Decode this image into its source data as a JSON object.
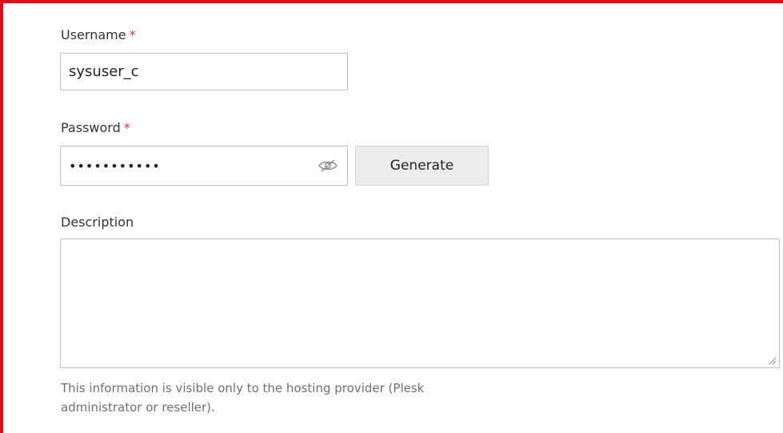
{
  "form": {
    "username": {
      "label": "Username",
      "required_mark": "*",
      "value": "sysuser_c"
    },
    "password": {
      "label": "Password",
      "required_mark": "*",
      "value": "•••••••••••",
      "toggle_icon": "eye-slash-icon",
      "generate_label": "Generate"
    },
    "description": {
      "label": "Description",
      "value": "",
      "help_line1": "This information is visible only to the hosting provider (Plesk",
      "help_line2": "administrator or reseller)."
    }
  },
  "colors": {
    "frame_border": "#e50914",
    "required": "#e0383e"
  }
}
